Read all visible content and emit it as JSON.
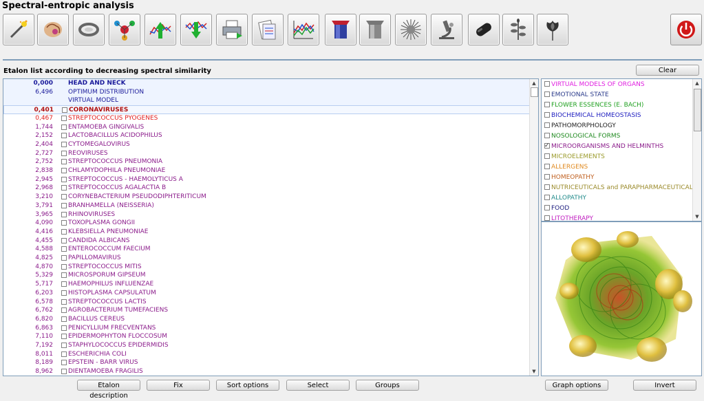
{
  "window": {
    "title": "Spectral-entropic analysis"
  },
  "toolbar": {
    "icons": [
      "wand-icon",
      "brain-icon",
      "ring-icon",
      "molecule-icon",
      "spectrum-up-icon",
      "spectrum-down-icon",
      "printer-icon",
      "clipboard-icon",
      "graph-icon",
      "cup-red-icon",
      "cup-gray-icon",
      "sunburst-icon",
      "microscope-icon",
      "capsule-icon",
      "herb-icon",
      "flower-icon"
    ],
    "power_icon": "power-icon"
  },
  "panel": {
    "label": "Etalon list according to decreasing spectral similarity",
    "clear_label": "Clear"
  },
  "etalons": [
    {
      "value": "0,000",
      "name": "HEAD AND NECK",
      "color": "#1a1a9a",
      "bold": true,
      "checkbox": false
    },
    {
      "value": "6,496",
      "name": "OPTIMUM DISTRIBUTION",
      "color": "#1a1a9a",
      "bold": false,
      "checkbox": false
    },
    {
      "value": "",
      "name": "VIRTUAL MODEL",
      "color": "#1a1a9a",
      "bold": false,
      "checkbox": false
    },
    {
      "value": "0,401",
      "name": "CORONAVIRUSES",
      "color": "#b01010",
      "bold": true,
      "checkbox": true
    },
    {
      "value": "0,467",
      "name": "STREPTOCOCCUS PYOGENES",
      "color": "#e02020",
      "bold": false,
      "checkbox": true
    },
    {
      "value": "1,744",
      "name": "ENTAMOEBA GINGIVALIS",
      "color": "#8a1a8a",
      "bold": false,
      "checkbox": true
    },
    {
      "value": "2,152",
      "name": "LACTOBACILLUS ACIDOPHILUS",
      "color": "#8a1a8a",
      "bold": false,
      "checkbox": true
    },
    {
      "value": "2,404",
      "name": "CYTOMEGALOVIRUS",
      "color": "#8a1a8a",
      "bold": false,
      "checkbox": true
    },
    {
      "value": "2,727",
      "name": "REOVIRUSES",
      "color": "#8a1a8a",
      "bold": false,
      "checkbox": true
    },
    {
      "value": "2,752",
      "name": "STREPTOCOCCUS  PNEUMONIA",
      "color": "#8a1a8a",
      "bold": false,
      "checkbox": true
    },
    {
      "value": "2,838",
      "name": "CHLAMYDOPHILA  PNEUMONIAE",
      "color": "#8a1a8a",
      "bold": false,
      "checkbox": true
    },
    {
      "value": "2,945",
      "name": "STREPTOCOCCUS - HAEMOLYTICUS  A",
      "color": "#8a1a8a",
      "bold": false,
      "checkbox": true
    },
    {
      "value": "2,968",
      "name": "STREPTOCOCCUS  AGALACTIA  B",
      "color": "#8a1a8a",
      "bold": false,
      "checkbox": true
    },
    {
      "value": "3,210",
      "name": "CORYNEBACTERIUM PSEUDODIPHTERITICUM",
      "color": "#8a1a8a",
      "bold": false,
      "checkbox": true
    },
    {
      "value": "3,791",
      "name": "BRANHAMELLA (NEISSERIA)",
      "color": "#8a1a8a",
      "bold": false,
      "checkbox": true
    },
    {
      "value": "3,965",
      "name": "RHINOVIRUSES",
      "color": "#8a1a8a",
      "bold": false,
      "checkbox": true
    },
    {
      "value": "4,090",
      "name": "TOXOPLASMA  GONGII",
      "color": "#8a1a8a",
      "bold": false,
      "checkbox": true
    },
    {
      "value": "4,416",
      "name": "KLEBSIELLA PNEUMONIAE",
      "color": "#8a1a8a",
      "bold": false,
      "checkbox": true
    },
    {
      "value": "4,455",
      "name": "CANDIDA  ALBICANS",
      "color": "#8a1a8a",
      "bold": false,
      "checkbox": true
    },
    {
      "value": "4,588",
      "name": "ENTEROCOCCUM  FAECIUM",
      "color": "#8a1a8a",
      "bold": false,
      "checkbox": true
    },
    {
      "value": "4,825",
      "name": "PAPILLOMAVIRUS",
      "color": "#8a1a8a",
      "bold": false,
      "checkbox": true
    },
    {
      "value": "4,870",
      "name": "STREPTOCOCCUS MITIS",
      "color": "#8a1a8a",
      "bold": false,
      "checkbox": true
    },
    {
      "value": "5,329",
      "name": "MICROSPORUM GIPSEUM",
      "color": "#8a1a8a",
      "bold": false,
      "checkbox": true
    },
    {
      "value": "5,717",
      "name": "HAEMOPHILUS INFLUENZAE",
      "color": "#8a1a8a",
      "bold": false,
      "checkbox": true
    },
    {
      "value": "6,203",
      "name": "HISTOPLASMA CAPSULATUM",
      "color": "#8a1a8a",
      "bold": false,
      "checkbox": true
    },
    {
      "value": "6,578",
      "name": "STREPTOCOCCUS LACTIS",
      "color": "#8a1a8a",
      "bold": false,
      "checkbox": true
    },
    {
      "value": "6,762",
      "name": "AGROBACTERIUM TUMEFACIENS",
      "color": "#8a1a8a",
      "bold": false,
      "checkbox": true
    },
    {
      "value": "6,820",
      "name": "BACILLUS CEREUS",
      "color": "#8a1a8a",
      "bold": false,
      "checkbox": true
    },
    {
      "value": "6,863",
      "name": "PENICYLLIUM  FRECVENTANS",
      "color": "#8a1a8a",
      "bold": false,
      "checkbox": true
    },
    {
      "value": "7,110",
      "name": "EPIDERMOPHYTON  FLOCCOSUM",
      "color": "#8a1a8a",
      "bold": false,
      "checkbox": true
    },
    {
      "value": "7,192",
      "name": "STAPHYLOCOCCUS EPIDERMIDIS",
      "color": "#8a1a8a",
      "bold": false,
      "checkbox": true
    },
    {
      "value": "8,011",
      "name": "ESCHERICHIA  COLI",
      "color": "#8a1a8a",
      "bold": false,
      "checkbox": true
    },
    {
      "value": "8,189",
      "name": "EPSTEIN - BARR VIRUS",
      "color": "#8a1a8a",
      "bold": false,
      "checkbox": true
    },
    {
      "value": "8,962",
      "name": "DIENTAMOEBA FRAGILIS",
      "color": "#8a1a8a",
      "bold": false,
      "checkbox": true
    }
  ],
  "categories": [
    {
      "label": "VIRTUAL MODELS OF ORGANS",
      "color": "#e020e0",
      "checked": false
    },
    {
      "label": "EMOTIONAL STATE",
      "color": "#2a3a8a",
      "checked": false
    },
    {
      "label": "FLOWER ESSENCES (E. BACH)",
      "color": "#20a020",
      "checked": false
    },
    {
      "label": "BIOCHEMICAL HOMEOSTASIS",
      "color": "#2020c0",
      "checked": false
    },
    {
      "label": "PATHOMORPHOLOGY",
      "color": "#202020",
      "checked": false
    },
    {
      "label": "NOSOLOGICAL FORMS",
      "color": "#208a20",
      "checked": false
    },
    {
      "label": "MICROORGANISMS AND HELMINTHS",
      "color": "#8a1a8a",
      "checked": true
    },
    {
      "label": "MICROELEMENTS",
      "color": "#9a9a2a",
      "checked": false
    },
    {
      "label": "ALLERGENS",
      "color": "#e08a20",
      "checked": false
    },
    {
      "label": "HOMEOPATHY",
      "color": "#c06020",
      "checked": false
    },
    {
      "label": "NUTRICEUTICALS and PARAPHARMACEUTICALS",
      "color": "#9a8a2a",
      "checked": false
    },
    {
      "label": "ALLOPATHY",
      "color": "#208a8a",
      "checked": false
    },
    {
      "label": "FOOD",
      "color": "#202080",
      "checked": false
    },
    {
      "label": "LITOTHERAPY",
      "color": "#c020c0",
      "checked": false
    }
  ],
  "bottom_buttons": {
    "etalon_description": "Etalon description",
    "fix": "Fix",
    "sort_options": "Sort options",
    "select": "Select",
    "groups": "Groups",
    "graph_options": "Graph options",
    "invert": "Invert"
  }
}
